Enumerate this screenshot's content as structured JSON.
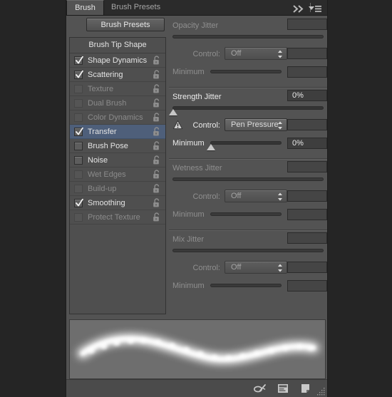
{
  "window": {
    "background_color": "#252525",
    "panel_background": "#535353",
    "accent_selection": "#4e5f7a"
  },
  "tabs": [
    {
      "label": "Brush",
      "active": true
    },
    {
      "label": "Brush Presets",
      "active": false
    }
  ],
  "tab_tools": {
    "collapse_icon": "double-chevron-right-icon",
    "menu_icon": "panel-menu-icon"
  },
  "toolbar": {
    "brush_presets_label": "Brush Presets"
  },
  "brush_list": {
    "header": "Brush Tip Shape",
    "items": [
      {
        "label": "Shape Dynamics",
        "checked": true,
        "enabled": true,
        "selected": false,
        "locked": false
      },
      {
        "label": "Scattering",
        "checked": true,
        "enabled": true,
        "selected": false,
        "locked": false
      },
      {
        "label": "Texture",
        "checked": false,
        "enabled": false,
        "selected": false,
        "locked": false
      },
      {
        "label": "Dual Brush",
        "checked": false,
        "enabled": false,
        "selected": false,
        "locked": false
      },
      {
        "label": "Color Dynamics",
        "checked": false,
        "enabled": false,
        "selected": false,
        "locked": false
      },
      {
        "label": "Transfer",
        "checked": true,
        "enabled": true,
        "selected": true,
        "locked": false
      },
      {
        "label": "Brush Pose",
        "checked": false,
        "enabled": true,
        "selected": false,
        "locked": false
      },
      {
        "label": "Noise",
        "checked": false,
        "enabled": true,
        "selected": false,
        "locked": false
      },
      {
        "label": "Wet Edges",
        "checked": false,
        "enabled": false,
        "selected": false,
        "locked": false
      },
      {
        "label": "Build-up",
        "checked": false,
        "enabled": false,
        "selected": false,
        "locked": false
      },
      {
        "label": "Smoothing",
        "checked": true,
        "enabled": true,
        "selected": false,
        "locked": false
      },
      {
        "label": "Protect Texture",
        "checked": false,
        "enabled": false,
        "selected": false,
        "locked": false
      }
    ]
  },
  "options": {
    "control_label": "Control:",
    "minimum_label": "Minimum",
    "groups": [
      {
        "id": "opacity_jitter",
        "title": "Opacity Jitter",
        "enabled": false,
        "value": "",
        "slider_pct": 0,
        "control_value": "Off",
        "minimum_value": "",
        "minimum_pct": 0,
        "warning": false
      },
      {
        "id": "strength_jitter",
        "title": "Strength Jitter",
        "enabled": true,
        "value": "0%",
        "slider_pct": 0,
        "control_value": "Pen Pressure",
        "minimum_value": "0%",
        "minimum_pct": 0,
        "warning": true
      },
      {
        "id": "wetness_jitter",
        "title": "Wetness Jitter",
        "enabled": false,
        "value": "",
        "slider_pct": 0,
        "control_value": "Off",
        "minimum_value": "",
        "minimum_pct": 0,
        "warning": false
      },
      {
        "id": "mix_jitter",
        "title": "Mix Jitter",
        "enabled": false,
        "value": "",
        "slider_pct": 0,
        "control_value": "Off",
        "minimum_value": "",
        "minimum_pct": 0,
        "warning": false
      }
    ]
  },
  "preview": {
    "name": "brush-stroke-preview",
    "background_color": "#6e6e6e",
    "stroke_color": "#ffffff"
  },
  "bottom_toolbar": {
    "icons": [
      {
        "name": "toggle-painting-options-icon"
      },
      {
        "name": "create-new-brush-preset-icon"
      },
      {
        "name": "new-brush-icon"
      }
    ],
    "resize_grip": "resize-grip-icon"
  }
}
